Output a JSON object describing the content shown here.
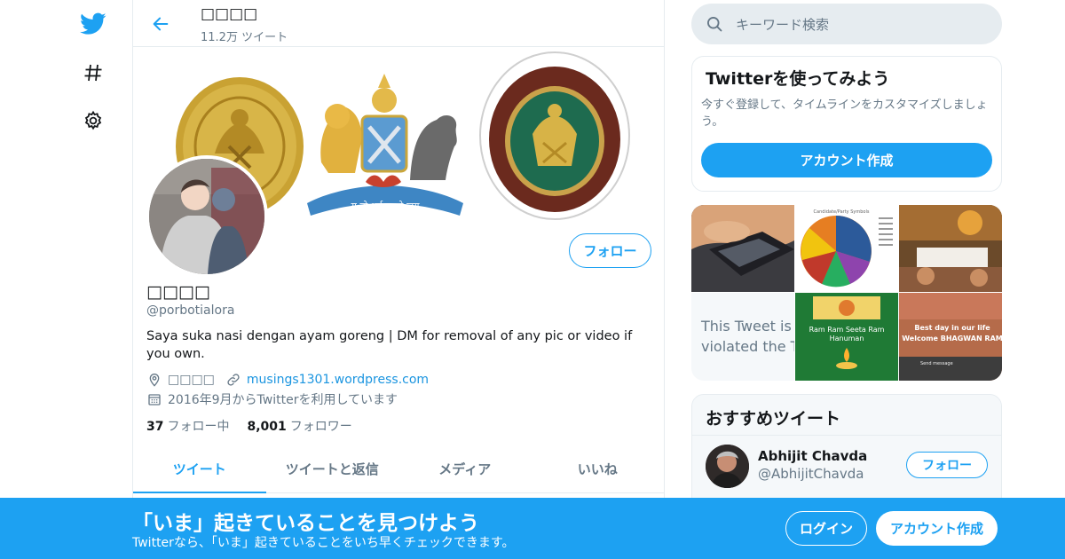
{
  "colors": {
    "accent": "#1da1f2",
    "link": "#1b95e0",
    "muted": "#657786",
    "border": "#e6ecf0"
  },
  "nav": {
    "icons": [
      "twitter-logo-icon",
      "hashtag-icon",
      "gear-icon"
    ]
  },
  "header": {
    "title": "□□□□",
    "tweet_count": "11.2万 ツイート"
  },
  "profile": {
    "name": "□□□□",
    "handle": "@porbotialora",
    "bio": "Saya suka nasi dengan ayam goreng | DM for removal of any pic or video if you own.",
    "location": "□□□□",
    "website": "musings1301.wordpress.com",
    "joined": "2016年9月からTwitterを利用しています",
    "following_count": "37",
    "following_label": "フォロー中",
    "followers_count": "8,001",
    "followers_label": "フォロワー",
    "follow_button": "フォロー",
    "banner_motto": "य तो धर्म स्ततो जय"
  },
  "tabs": [
    {
      "label": "ツイート",
      "active": true
    },
    {
      "label": "ツイートと返信",
      "active": false
    },
    {
      "label": "メディア",
      "active": false
    },
    {
      "label": "いいね",
      "active": false
    }
  ],
  "search": {
    "placeholder": "キーワード検索"
  },
  "signup_card": {
    "title": "Twitterを使ってみよう",
    "text": "今すぐ登録して、タイムラインをカスタマイズしましょう。",
    "button": "アカウント作成"
  },
  "media": {
    "withheld_text": "This Tweet is violated the T",
    "caption_1": "Ram Ram Seeta Ram",
    "caption_1b": "Hanuman",
    "caption_2": "Best day in our life",
    "caption_2b": "Welcome BHAGWAN RAM",
    "caption_2c": "Send message",
    "pie_title": "Candidate/Party Symbols"
  },
  "recommend": {
    "title": "おすすめツイート",
    "user_name": "Abhijit Chavda",
    "user_handle": "@AbhijitChavda",
    "follow": "フォロー"
  },
  "bottom_bar": {
    "title": "「いま」起きていることを見つけよう",
    "subtitle": "Twitterなら、「いま」起きていることをいち早くチェックできます。",
    "login": "ログイン",
    "signup": "アカウント作成"
  }
}
